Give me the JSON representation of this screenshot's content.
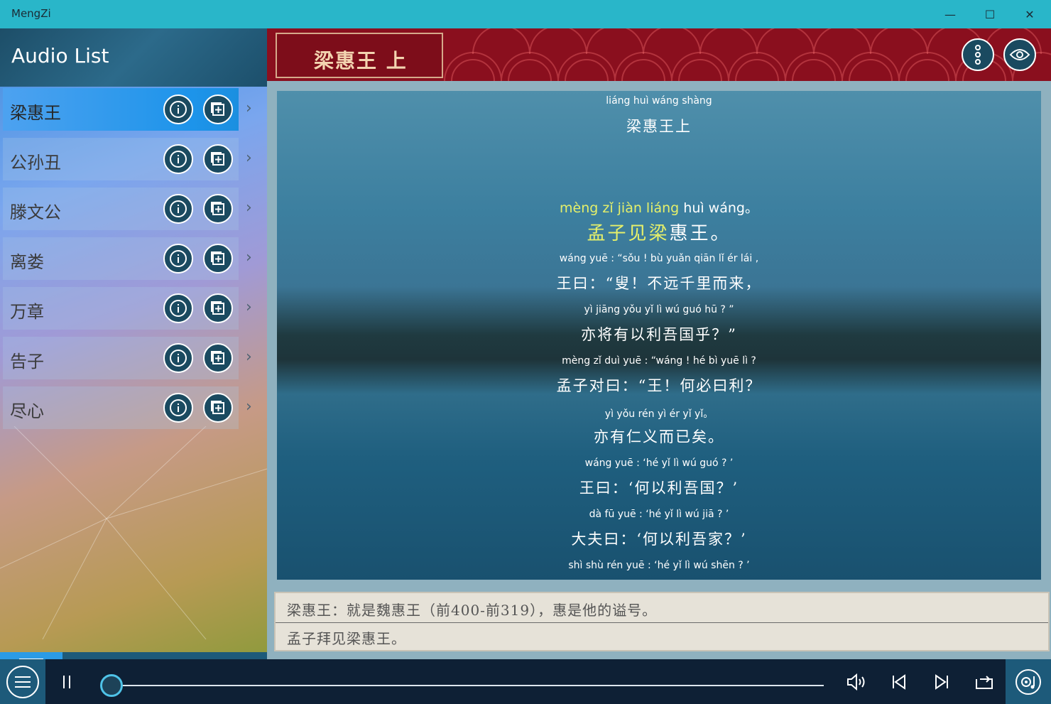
{
  "window": {
    "title": "MengZi",
    "minimize_glyph": "—",
    "maximize_glyph": "☐",
    "close_glyph": "✕"
  },
  "sidebar": {
    "heading": "Audio List",
    "items": [
      {
        "label": "梁惠王",
        "active": true
      },
      {
        "label": "公孙丑",
        "active": false
      },
      {
        "label": "滕文公",
        "active": false
      },
      {
        "label": "离娄",
        "active": false
      },
      {
        "label": "万章",
        "active": false
      },
      {
        "label": "告子",
        "active": false
      },
      {
        "label": "尽心",
        "active": false
      }
    ],
    "tabs": [
      "list-icon",
      "history-icon",
      "heart-icon",
      "tools-icon"
    ]
  },
  "chapter": {
    "title": "梁惠王 上"
  },
  "text": {
    "title_pinyin": "liáng huì wáng shàng",
    "title_hanzi": "梁惠王上",
    "current": {
      "pinyin_hl": "mèng zǐ jiàn liáng",
      "pinyin_rest": " huì wáng。",
      "hanzi_hl": "孟子见梁",
      "hanzi_rest": "惠王。"
    },
    "lines": [
      {
        "pinyin": "wáng yuē : “sǒu ! bù yuǎn qiān lǐ ér lái ,",
        "hanzi": "王曰：“叟！不远千里而来，"
      },
      {
        "pinyin": "yì jiāng yǒu yǐ lì wú guó hū ? ”",
        "hanzi": "亦将有以利吾国乎？”"
      },
      {
        "pinyin": "mèng zǐ duì yuē : “wáng ! hé bì yuē lì ?",
        "hanzi": "孟子对曰：“王！何必曰利？"
      },
      {
        "pinyin": "yì yǒu rén yì ér yǐ yǐ。",
        "hanzi": "亦有仁义而已矣。"
      },
      {
        "pinyin": "wáng yuē : ‘hé yǐ lì wú guó ? ’",
        "hanzi": "王曰：‘何以利吾国？’"
      },
      {
        "pinyin": "dà fū yuē : ‘hé yǐ lì wú jiā ? ’",
        "hanzi": "大夫曰：‘何以利吾家？’"
      },
      {
        "pinyin": "shì shù rén yuē : ‘hé yǐ lì wú shēn ? ’",
        "hanzi": ""
      }
    ]
  },
  "notes": {
    "line1": "梁惠王：就是魏惠王（前400-前319），惠是他的谥号。",
    "line2": "孟子拜见梁惠王。"
  },
  "player": {
    "progress": 0.0,
    "icons": [
      "menu-icon",
      "pause-icon",
      "volume-icon",
      "previous-icon",
      "next-icon",
      "repeat-icon",
      "disc-icon"
    ]
  },
  "colors": {
    "titlebar": "#29b6c9",
    "accent": "#1d94ea",
    "banner": "#8a0f1e",
    "highlight": "#e6f06a"
  }
}
